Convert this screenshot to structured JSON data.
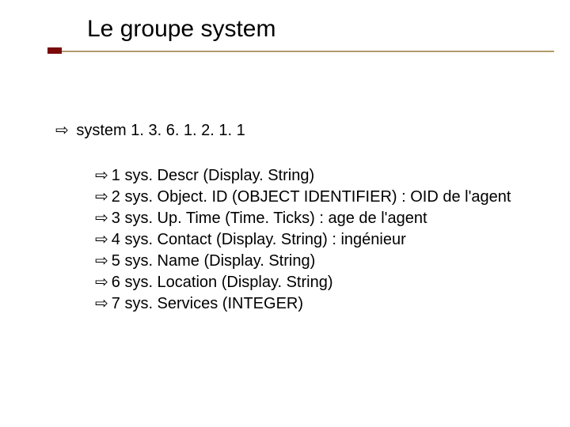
{
  "title": "Le groupe system",
  "main_item": "system 1. 3. 6. 1. 2. 1. 1",
  "sub_items": [
    "1 sys. Descr (Display. String)",
    "2 sys. Object. ID (OBJECT IDENTIFIER) : OID de l'agent",
    "3 sys. Up. Time (Time. Ticks) : age de l'agent",
    "4 sys. Contact (Display. String) : ingénieur",
    "5 sys. Name (Display. String)",
    "6 sys. Location (Display. String)",
    "7 sys. Services (INTEGER)"
  ],
  "bullet": "⇨"
}
